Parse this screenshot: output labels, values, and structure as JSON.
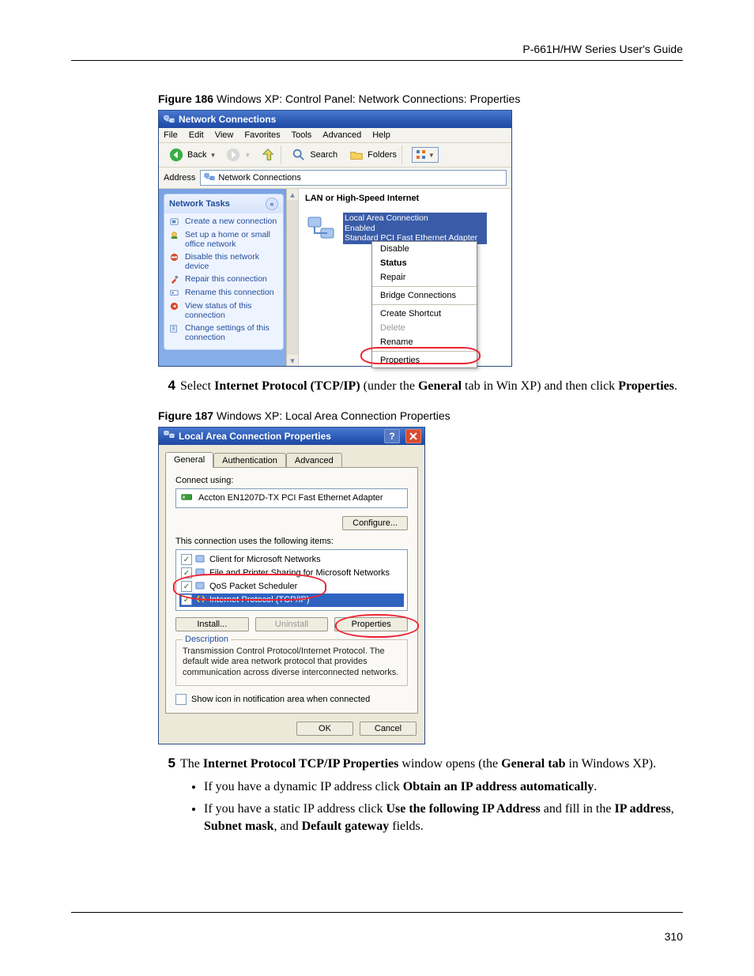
{
  "header": {
    "guide": "P-661H/HW Series User's Guide"
  },
  "figure186": {
    "caption_prefix": "Figure 186",
    "caption_text": "   Windows XP: Control Panel: Network Connections: Properties"
  },
  "nc": {
    "title": "Network Connections",
    "menu": {
      "file": "File",
      "edit": "Edit",
      "view": "View",
      "favorites": "Favorites",
      "tools": "Tools",
      "advanced": "Advanced",
      "help": "Help"
    },
    "toolbar": {
      "back": "Back",
      "search": "Search",
      "folders": "Folders"
    },
    "address_label": "Address",
    "address_value": "Network Connections",
    "tasks_title": "Network Tasks",
    "tasks": [
      "Create a new connection",
      "Set up a home or small office network",
      "Disable this network device",
      "Repair this connection",
      "Rename this connection",
      "View status of this connection",
      "Change settings of this connection"
    ],
    "group_head": "LAN or High-Speed Internet",
    "conn": {
      "name": "Local Area Connection",
      "status": "Enabled",
      "adapter": "Standard PCI Fast Ethernet Adapter"
    },
    "ctx": {
      "disable": "Disable",
      "status": "Status",
      "repair": "Repair",
      "bridge": "Bridge Connections",
      "shortcut": "Create Shortcut",
      "delete": "Delete",
      "rename": "Rename",
      "properties": "Properties"
    }
  },
  "step4": {
    "num": "4",
    "p1a": "Select ",
    "p1b": "Internet Protocol (TCP/IP)",
    "p1c": " (under the ",
    "p1d": "General",
    "p1e": " tab in Win XP) and then click ",
    "p1f": "Properties",
    "p1g": "."
  },
  "figure187": {
    "caption_prefix": "Figure 187",
    "caption_text": "   Windows XP: Local Area Connection Properties"
  },
  "lac": {
    "title": "Local Area Connection Properties",
    "tabs": {
      "general": "General",
      "auth": "Authentication",
      "advanced": "Advanced"
    },
    "connect_using": "Connect using:",
    "adapter": "Accton EN1207D-TX PCI Fast Ethernet Adapter",
    "configure": "Configure...",
    "uses_label": "This connection uses the following items:",
    "items": [
      "Client for Microsoft Networks",
      "File and Printer Sharing for Microsoft Networks",
      "QoS Packet Scheduler",
      "Internet Protocol (TCP/IP)"
    ],
    "install": "Install...",
    "uninstall": "Uninstall",
    "properties": "Properties",
    "desc_label": "Description",
    "desc_text": "Transmission Control Protocol/Internet Protocol. The default wide area network protocol that provides communication across diverse interconnected networks.",
    "show_icon": "Show icon in notification area when connected",
    "ok": "OK",
    "cancel": "Cancel"
  },
  "step5": {
    "num": "5",
    "a": "The ",
    "b": "Internet Protocol TCP/IP Properties",
    "c": " window opens (the ",
    "d": "General tab",
    "e": " in Windows XP).",
    "bullets": [
      {
        "a": "If you have a dynamic IP address click ",
        "b": "Obtain an IP address automatically",
        "c": "."
      },
      {
        "a": "If you have a static IP address click ",
        "b": "Use the following IP Address",
        "c": " and fill in the ",
        "d": "IP address",
        "e": ", ",
        "f": "Subnet mask",
        "g": ", and ",
        "h": "Default gateway",
        "i": " fields."
      }
    ]
  },
  "page_number": "310"
}
